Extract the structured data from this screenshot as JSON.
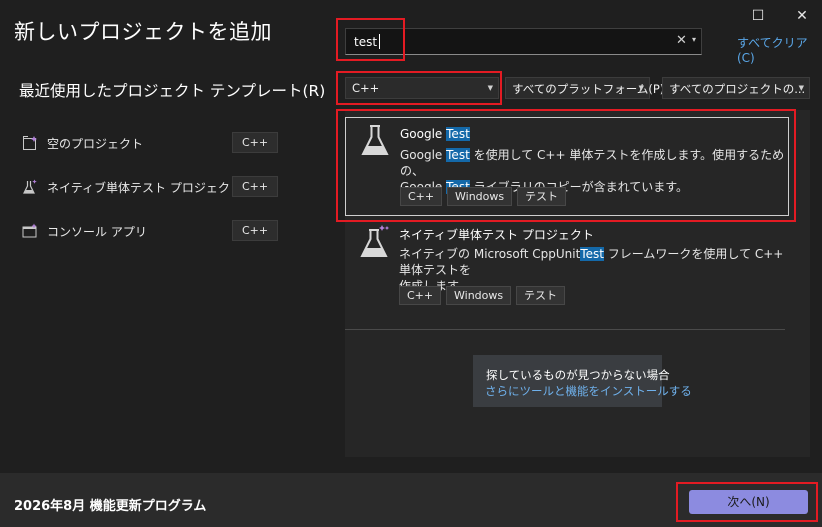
{
  "window": {
    "maximize_glyph": "☐",
    "close_glyph": "✕"
  },
  "header": {
    "title": "新しいプロジェクトを追加"
  },
  "recent": {
    "title": "最近使用したプロジェクト テンプレート(R)",
    "items": [
      {
        "label": "空のプロジェクト",
        "tag": "C++",
        "icon": "empty-project-icon"
      },
      {
        "label": "ネイティブ単体テスト プロジェクト",
        "tag": "C++",
        "icon": "flask-icon"
      },
      {
        "label": "コンソール アプリ",
        "tag": "C++",
        "icon": "console-app-icon"
      }
    ]
  },
  "search": {
    "value": "test",
    "clear_glyph": "✕",
    "dropdown_glyph": "▾",
    "clear_all": "すべてクリア(C)"
  },
  "filters": {
    "language": "C++",
    "platform": "すべてのプラットフォーム(P)",
    "project_type": "すべてのプロジェクトの..."
  },
  "results": [
    {
      "name_prefix": "Google ",
      "name_highlight": "Test",
      "desc_line1_a": "Google ",
      "desc_line1_hl": "Test",
      "desc_line1_b": " を使用して C++ 単体テストを作成します。使用するための、",
      "desc_line2_a": "Google ",
      "desc_line2_hl": "Test",
      "desc_line2_b": " ライブラリのコピーが含まれています。",
      "tags": [
        "C++",
        "Windows",
        "テスト"
      ]
    },
    {
      "name": "ネイティブ単体テスト プロジェクト",
      "desc_a": "ネイティブの Microsoft CppUnit",
      "desc_hl": "Test",
      "desc_b": " フレームワークを使用して C++ 単体テストを",
      "desc_line2": "作成します。",
      "tags": [
        "C++",
        "Windows",
        "テスト"
      ]
    }
  ],
  "not_found": {
    "line1": "探しているものが見つからない場合",
    "line2": "さらにツールと機能をインストールする"
  },
  "footer": {
    "version": "2026年8月 機能更新プログラム",
    "next_button": "次へ(N)"
  },
  "colors": {
    "background": "#1f1f1f",
    "accent": "#8c8be0",
    "highlight": "#1469a9",
    "link": "#5aa7e8",
    "annotation": "#e31b23"
  }
}
